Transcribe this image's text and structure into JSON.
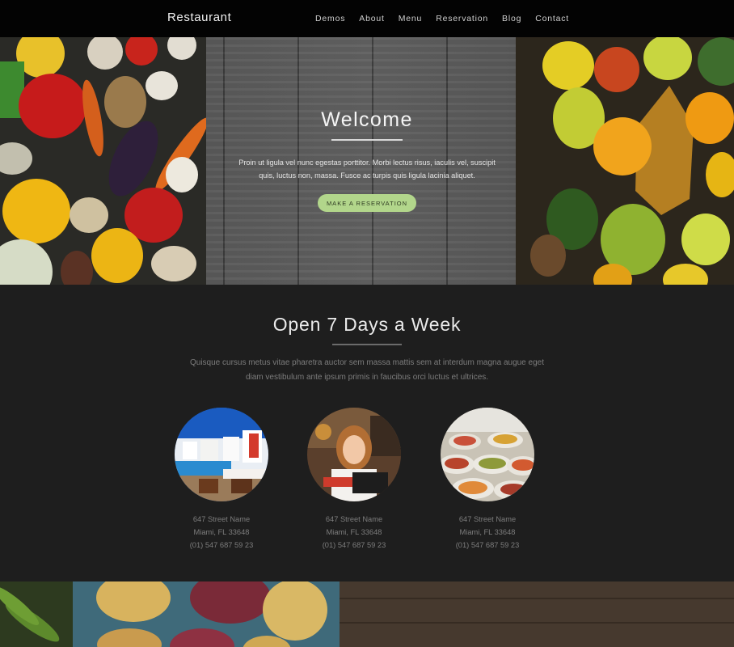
{
  "nav": {
    "brand": "Restaurant",
    "items": [
      "Demos",
      "About",
      "Menu",
      "Reservation",
      "Blog",
      "Contact"
    ]
  },
  "hero": {
    "title": "Welcome",
    "text": "Proin ut ligula vel nunc egestas porttitor. Morbi lectus risus, iaculis vel, suscipit quis, luctus non, massa. Fusce ac turpis quis ligula lacinia aliquet.",
    "button": "MAKE A RESERVATION",
    "button_color": "#b2d68b"
  },
  "open": {
    "title": "Open 7 Days a Week",
    "text": "Quisque cursus metus vitae pharetra auctor sem massa mattis sem at interdum magna augue eget diam vestibulum ante ipsum primis in faucibus orci luctus et ultrices."
  },
  "locations": [
    {
      "image": "seaside-restaurant-photo",
      "street": "647 Street Name",
      "city": "Miami, FL 33648",
      "phone": "(01) 547 687 59 23"
    },
    {
      "image": "waitress-photo",
      "street": "647 Street Name",
      "city": "Miami, FL 33648",
      "phone": "(01) 547 687 59 23"
    },
    {
      "image": "buffet-food-photo",
      "street": "647 Street Name",
      "city": "Miami, FL 33648",
      "phone": "(01) 547 687 59 23"
    }
  ],
  "colors": {
    "nav_bg": "#030303",
    "section_bg": "#1e1e1e",
    "accent": "#b2d68b"
  }
}
